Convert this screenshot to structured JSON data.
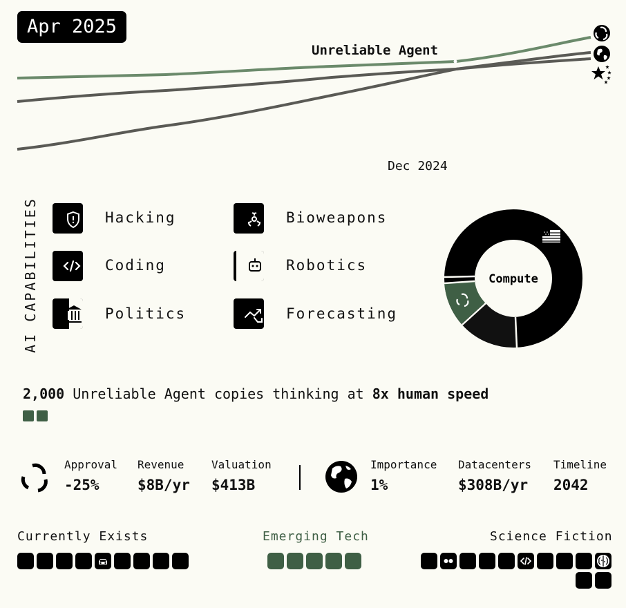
{
  "header": {
    "date": "Apr 2025"
  },
  "timeline_chart": {
    "agent_label": "Unreliable Agent",
    "marker_label": "Dec 2024",
    "accent_color": "#6b8a6b",
    "line_color": "#5a5a55",
    "end_icons": [
      "openbrain-logo-icon",
      "globe-icon",
      "china-stars-icon"
    ]
  },
  "capabilities": {
    "title": "AI CAPABILITIES",
    "items": [
      {
        "label": "Hacking",
        "icon": "shield-icon"
      },
      {
        "label": "Bioweapons",
        "icon": "biohazard-icon"
      },
      {
        "label": "Coding",
        "icon": "code-icon"
      },
      {
        "label": "Robotics",
        "icon": "robot-icon"
      },
      {
        "label": "Politics",
        "icon": "capitol-icon"
      },
      {
        "label": "Forecasting",
        "icon": "trend-icon"
      }
    ]
  },
  "compute": {
    "label": "Compute",
    "accent": "#3f5f45"
  },
  "agents": {
    "copies": "2,000",
    "name": " Unreliable Agent copies thinking at ",
    "speed": "8x human speed"
  },
  "stats": {
    "company": [
      {
        "label": "Approval",
        "value": "-25%"
      },
      {
        "label": "Revenue",
        "value": "$8B/yr"
      },
      {
        "label": "Valuation",
        "value": "$413B"
      }
    ],
    "world": [
      {
        "label": "Importance",
        "value": "1%"
      },
      {
        "label": "Datacenters",
        "value": "$308B/yr"
      },
      {
        "label": "Timeline",
        "value": "2042"
      }
    ]
  },
  "tech": {
    "exists": "Currently Exists",
    "emerging": "Emerging Tech",
    "scifi": "Science Fiction",
    "emerging_color": "#3f5f45"
  }
}
